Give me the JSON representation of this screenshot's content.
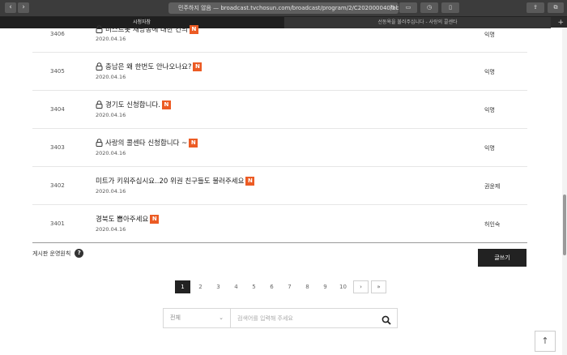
{
  "browser": {
    "url": "민주하지 않음 — broadcast.tvchosun.com/broadcast/program/2/C202000040/bb",
    "tabs": [
      "시청자참",
      "선동욕을 불러주십니다 - 사랑의 콜센타"
    ],
    "back_icon": "chevron-left-icon",
    "forward_icon": "chevron-right-icon"
  },
  "board": {
    "rows": [
      {
        "num": "3406",
        "title": "미스트롯 재방송에 대한 건의",
        "date": "2020.04.16",
        "author": "익명",
        "locked": true,
        "new_badge": "N"
      },
      {
        "num": "3405",
        "title": "충남은 왜 한번도 안나오나요?",
        "date": "2020.04.16",
        "author": "익명",
        "locked": true,
        "new_badge": "N"
      },
      {
        "num": "3404",
        "title": "경기도 신청합니다.",
        "date": "2020.04.16",
        "author": "익명",
        "locked": true,
        "new_badge": "N"
      },
      {
        "num": "3403",
        "title": "사랑의 콜센타 신청합니다 ~",
        "date": "2020.04.16",
        "author": "익명",
        "locked": true,
        "new_badge": "N"
      },
      {
        "num": "3402",
        "title": "미트가 키워주십시요..20 위권 친구들도 불러주세요",
        "date": "2020.04.16",
        "author": "권윤제",
        "locked": false,
        "new_badge": "N"
      },
      {
        "num": "3401",
        "title": "경북도 뽑아주세요",
        "date": "2020.04.16",
        "author": "허인숙",
        "locked": false,
        "new_badge": "N"
      }
    ],
    "policy_label": "게시판 운영원칙",
    "policy_icon": "?",
    "write_button": "글쓰기"
  },
  "pagination": {
    "pages": [
      "1",
      "2",
      "3",
      "4",
      "5",
      "6",
      "7",
      "8",
      "9",
      "10"
    ],
    "current": "1",
    "next": "›",
    "last": "»"
  },
  "search": {
    "select_value": "전체",
    "placeholder": "검색어를 입력해 주세요"
  },
  "scroll_top": "↑"
}
